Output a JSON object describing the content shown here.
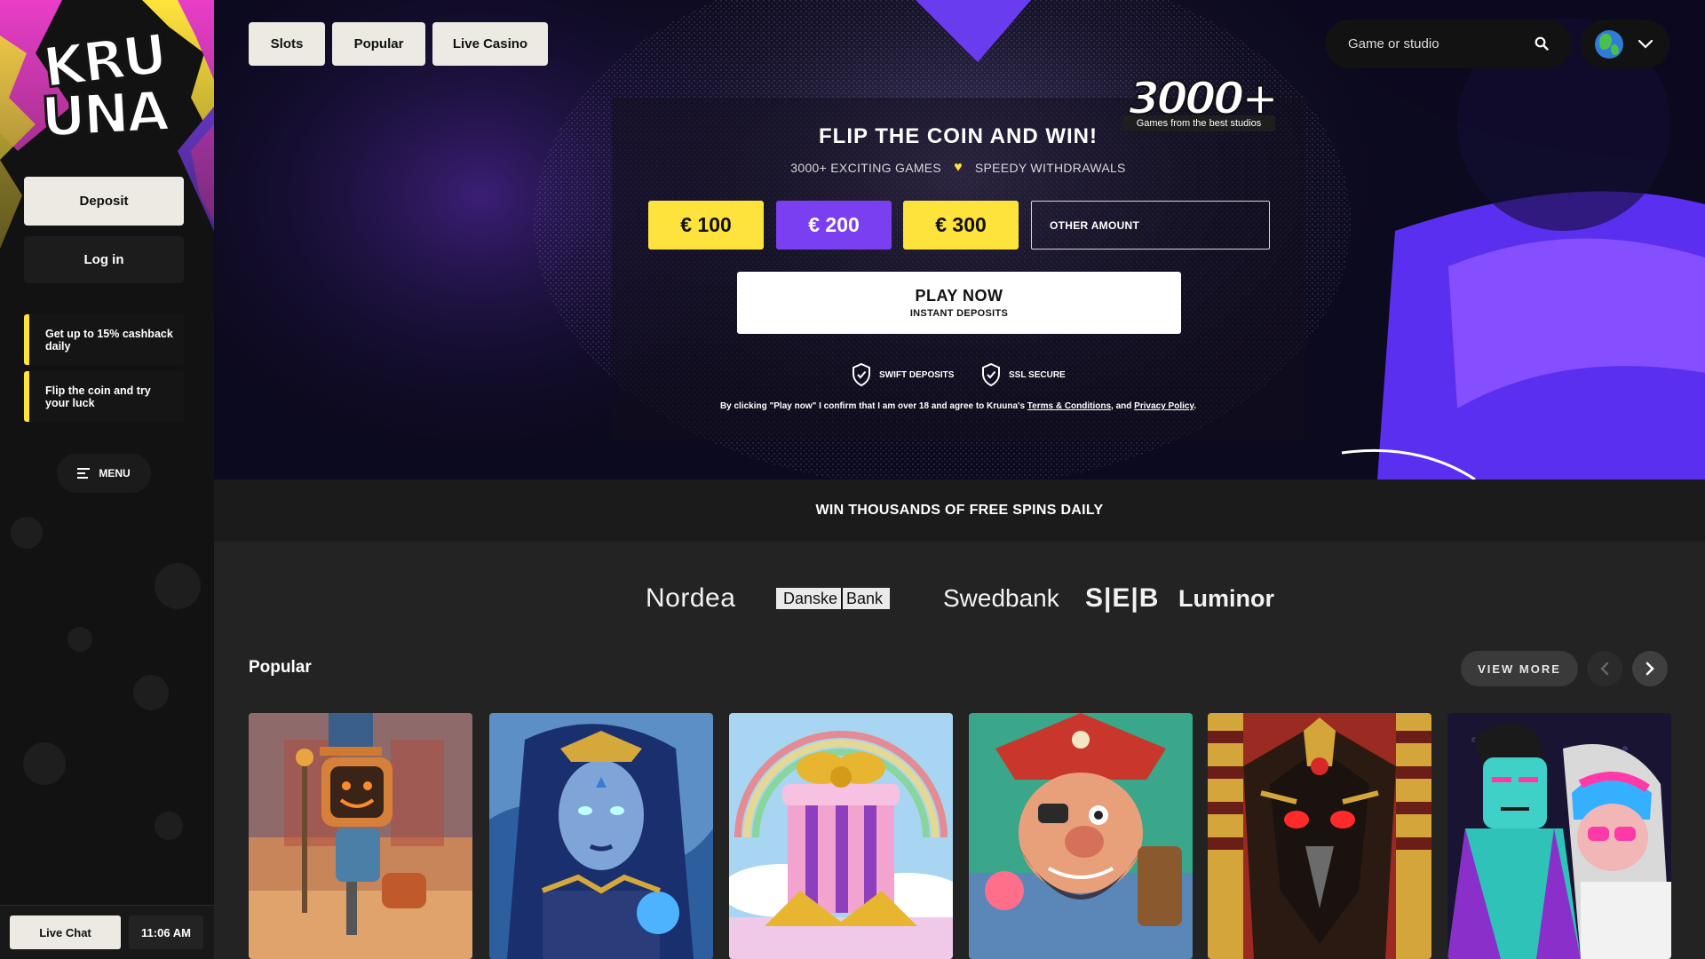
{
  "sidebar": {
    "logo_line1": "KRU",
    "logo_line2": "UNA",
    "deposit_label": "Deposit",
    "login_label": "Log in",
    "promos": [
      {
        "text": "Get up to 15% cashback daily"
      },
      {
        "text": "Flip the coin and try your luck"
      }
    ],
    "menu_label": "MENU",
    "live_chat_label": "Live Chat",
    "time": "11:06 AM"
  },
  "nav": {
    "tabs": [
      {
        "label": "Slots"
      },
      {
        "label": "Popular"
      },
      {
        "label": "Live Casino"
      }
    ],
    "search_placeholder": "Game or studio",
    "language_icon": "globe-icon"
  },
  "hero": {
    "badge_number": "3000+",
    "badge_caption": "Games from the best studios",
    "title": "FLIP THE COIN AND WIN!",
    "feature_left": "3000+ EXCITING GAMES",
    "feature_right": "SPEEDY WITHDRAWALS",
    "amounts": [
      {
        "label": "€ 100",
        "color": "#ffe33d"
      },
      {
        "label": "€ 200",
        "color": "#7b3ff2"
      },
      {
        "label": "€ 300",
        "color": "#ffe33d"
      }
    ],
    "other_amount_placeholder": "OTHER AMOUNT",
    "play_label": "PLAY NOW",
    "play_sub": "INSTANT DEPOSITS",
    "trust_badges": [
      {
        "label": "SWIFT DEPOSITS",
        "icon": "shield-check-icon"
      },
      {
        "label": "SSL SECURE",
        "icon": "shield-check-icon"
      }
    ],
    "legal_prefix": "By clicking \"Play now\" I confirm that I am over 18 and agree to Kruuna's ",
    "legal_terms": "Terms & Conditions",
    "legal_middle": ", and ",
    "legal_privacy": "Privacy Policy",
    "legal_suffix": "."
  },
  "banner": {
    "text": "WIN THOUSANDS OF FREE SPINS DAILY"
  },
  "banks": {
    "nordea": "Nordea",
    "danske_left": "Danske",
    "danske_right": "Bank",
    "swedbank": "Swedbank",
    "seb": "S|E|B",
    "luminor": "Luminor"
  },
  "popular": {
    "title": "Popular",
    "view_more": "VIEW MORE",
    "games": [
      {
        "name": "robot-game-thumbnail"
      },
      {
        "name": "sorceress-game-thumbnail"
      },
      {
        "name": "gift-box-game-thumbnail"
      },
      {
        "name": "pirate-game-thumbnail"
      },
      {
        "name": "pharaoh-game-thumbnail"
      },
      {
        "name": "punk-duo-game-thumbnail"
      }
    ]
  },
  "colors": {
    "accent_yellow": "#ffe33d",
    "accent_purple": "#7b3ff2",
    "cream": "#eceae2"
  }
}
